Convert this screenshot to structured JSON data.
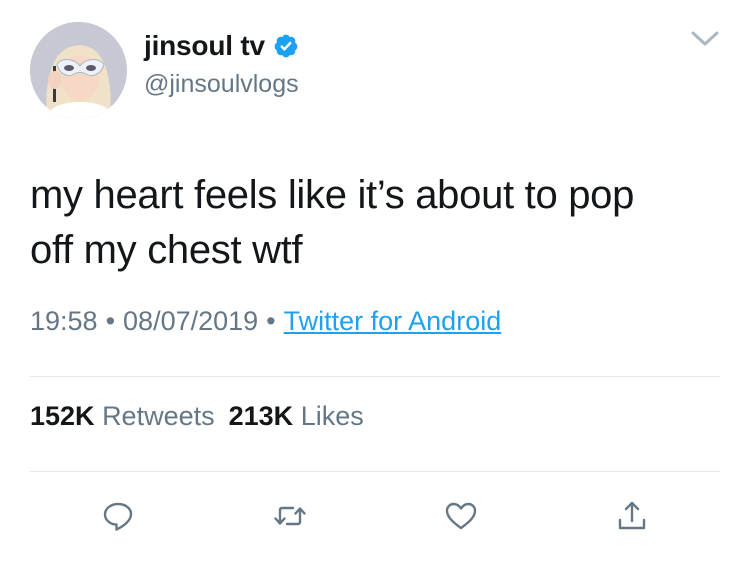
{
  "user": {
    "display_name": "jinsoul tv",
    "handle": "@jinsoulvlogs",
    "verified": true
  },
  "tweet": {
    "text_lines": [
      "my heart feels like it’s about to pop",
      "off my chest wtf"
    ]
  },
  "meta": {
    "time": "19:58",
    "separator": "•",
    "date": "08/07/2019",
    "source": "Twitter for Android"
  },
  "stats": {
    "retweets_count": "152K",
    "retweets_label": "Retweets",
    "likes_count": "213K",
    "likes_label": "Likes"
  },
  "icons": {
    "more": "chevron-down-icon",
    "verified": "verified-badge-icon",
    "reply": "reply-icon",
    "retweet": "retweet-icon",
    "like": "heart-icon",
    "share": "share-icon"
  },
  "colors": {
    "text": "#14171a",
    "secondary": "#657786",
    "link": "#1da1f2",
    "divider": "#e1e8ed",
    "verified": "#1da1f2"
  }
}
